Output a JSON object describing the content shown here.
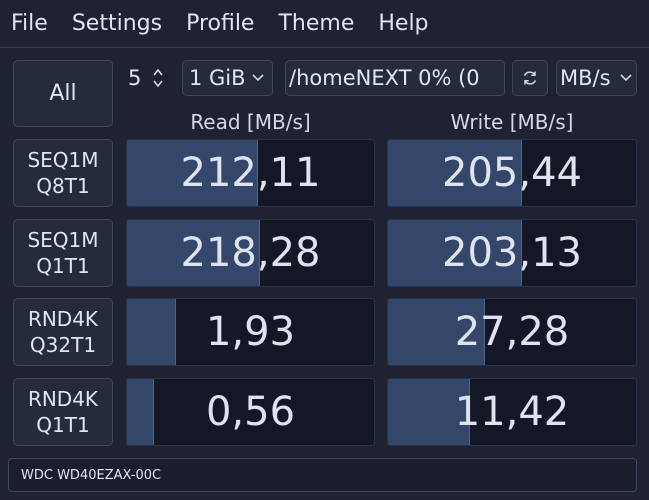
{
  "menu": [
    "File",
    "Settings",
    "Profile",
    "Theme",
    "Help"
  ],
  "toolbar": {
    "all_label": "All",
    "count_value": "5",
    "size_value": "1 GiB",
    "path_value": "/homeNEXT 0% (0",
    "unit_value": "MB/s",
    "refresh_icon": "refresh-icon"
  },
  "columns": {
    "read": "Read [MB/s]",
    "write": "Write [MB/s]"
  },
  "rows": [
    {
      "label_line1": "SEQ1M",
      "label_line2": "Q8T1",
      "read": "212,11",
      "write": "205,44",
      "read_fill": 0.53,
      "write_fill": 0.54
    },
    {
      "label_line1": "SEQ1M",
      "label_line2": "Q1T1",
      "read": "218,28",
      "write": "203,13",
      "read_fill": 0.54,
      "write_fill": 0.54
    },
    {
      "label_line1": "RND4K",
      "label_line2": "Q32T1",
      "read": "1,93",
      "write": "27,28",
      "read_fill": 0.2,
      "write_fill": 0.39
    },
    {
      "label_line1": "RND4K",
      "label_line2": "Q1T1",
      "read": "0,56",
      "write": "11,42",
      "read_fill": 0.11,
      "write_fill": 0.33
    }
  ],
  "status": "WDC WD40EZAX-00C"
}
